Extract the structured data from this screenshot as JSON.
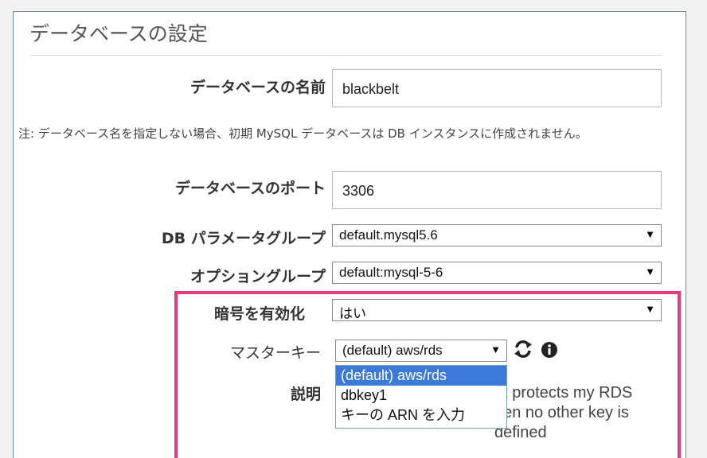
{
  "section": {
    "title": "データベースの設定"
  },
  "db_name": {
    "label": "データベースの名前",
    "value": "blackbelt"
  },
  "note": "注: データベース名を指定しない場合、初期 MySQL データベースは DB インスタンスに作成されません。",
  "port": {
    "label": "データベースのポート",
    "value": "3306"
  },
  "param_group": {
    "label": "DB パラメータグループ",
    "value": "default.mysql5.6"
  },
  "option_group": {
    "label": "オプショングループ",
    "value": "default:mysql-5-6"
  },
  "encryption": {
    "label": "暗号を有効化",
    "value": "はい"
  },
  "master_key": {
    "label": "マスターキー",
    "value": "(default) aws/rds",
    "options": [
      "(default) aws/rds",
      "dbkey1",
      "キーの ARN を入力"
    ]
  },
  "description": {
    "label": "説明",
    "text": "at protects my RDS\nhen no other key is\ndefined"
  },
  "icons": {
    "refresh": "refresh-icon",
    "info": "info-icon",
    "dropdown": "chevron-down-icon"
  },
  "colors": {
    "highlight": "#e6397a",
    "selected_option": "#3b7ad9",
    "panel_border": "#6f87a3"
  }
}
